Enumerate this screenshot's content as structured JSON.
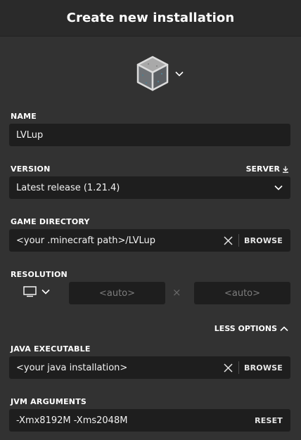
{
  "header": {
    "title": "Create new installation"
  },
  "icon": {
    "name": "grass-block-icon"
  },
  "name_section": {
    "label": "NAME",
    "value": "LVLup"
  },
  "version_section": {
    "label": "VERSION",
    "server_label": "SERVER",
    "selected": "Latest release (1.21.4)"
  },
  "game_directory": {
    "label": "GAME DIRECTORY",
    "value": "<your .minecraft path>/LVLup",
    "browse_label": "BROWSE"
  },
  "resolution": {
    "label": "RESOLUTION",
    "width_placeholder": "<auto>",
    "height_placeholder": "<auto>",
    "separator": "×"
  },
  "options_toggle": {
    "label": "LESS OPTIONS"
  },
  "java_executable": {
    "label": "JAVA EXECUTABLE",
    "value": "<your java installation>",
    "browse_label": "BROWSE"
  },
  "jvm_arguments": {
    "label": "JVM ARGUMENTS",
    "value": "-Xmx8192M -Xms2048M",
    "reset_label": "RESET"
  }
}
